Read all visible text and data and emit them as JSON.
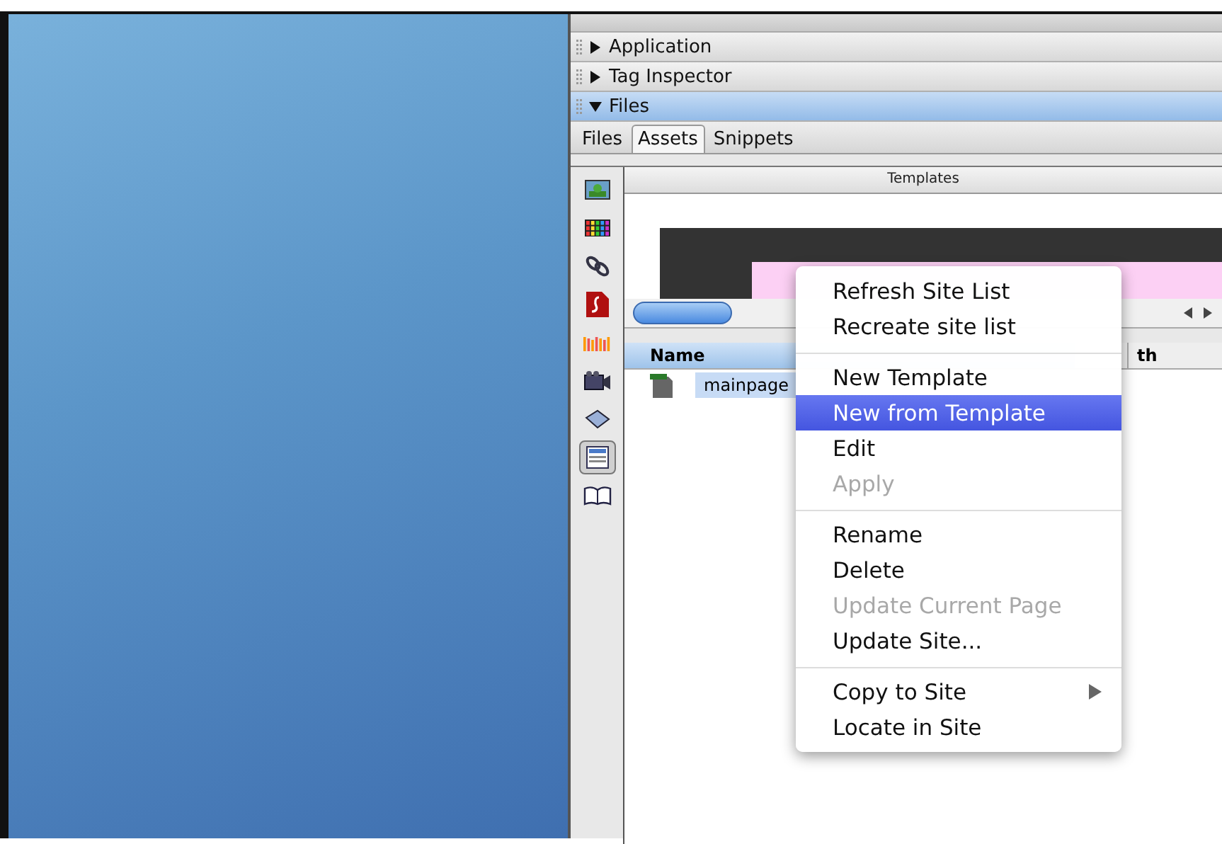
{
  "panels": [
    {
      "title": "Application",
      "expanded": false,
      "selected": false
    },
    {
      "title": "Tag Inspector",
      "expanded": false,
      "selected": false
    },
    {
      "title": "Files",
      "expanded": true,
      "selected": true
    }
  ],
  "tabs": [
    {
      "label": "Files",
      "selected": false
    },
    {
      "label": "Assets",
      "selected": true
    },
    {
      "label": "Snippets",
      "selected": false
    }
  ],
  "asset_categories": [
    {
      "kind": "image",
      "selected": false
    },
    {
      "kind": "colors",
      "selected": false
    },
    {
      "kind": "link",
      "selected": false
    },
    {
      "kind": "flash",
      "selected": false
    },
    {
      "kind": "shockwave",
      "selected": false
    },
    {
      "kind": "movie",
      "selected": false
    },
    {
      "kind": "script",
      "selected": false
    },
    {
      "kind": "template",
      "selected": true
    },
    {
      "kind": "library",
      "selected": false
    }
  ],
  "templates": {
    "title": "Templates",
    "columns": [
      "Name",
      "th"
    ],
    "rows": [
      {
        "name": "mainpage",
        "selected": true
      }
    ]
  },
  "context_menu": {
    "items": [
      {
        "kind": "item",
        "label": "Refresh Site List",
        "disabled": false,
        "selected": false
      },
      {
        "kind": "item",
        "label": "Recreate site list",
        "disabled": false,
        "selected": false
      },
      {
        "kind": "separator"
      },
      {
        "kind": "item",
        "label": "New Template",
        "disabled": false,
        "selected": false
      },
      {
        "kind": "item",
        "label": "New from Template",
        "disabled": false,
        "selected": true
      },
      {
        "kind": "item",
        "label": "Edit",
        "disabled": false,
        "selected": false
      },
      {
        "kind": "item",
        "label": "Apply",
        "disabled": true,
        "selected": false
      },
      {
        "kind": "separator"
      },
      {
        "kind": "item",
        "label": "Rename",
        "disabled": false,
        "selected": false
      },
      {
        "kind": "item",
        "label": "Delete",
        "disabled": false,
        "selected": false
      },
      {
        "kind": "item",
        "label": "Update Current Page",
        "disabled": true,
        "selected": false
      },
      {
        "kind": "item",
        "label": "Update Site...",
        "disabled": false,
        "selected": false
      },
      {
        "kind": "separator"
      },
      {
        "kind": "submenu",
        "label": "Copy to Site",
        "disabled": false,
        "selected": false
      },
      {
        "kind": "item",
        "label": "Locate in Site",
        "disabled": false,
        "selected": false
      }
    ]
  }
}
